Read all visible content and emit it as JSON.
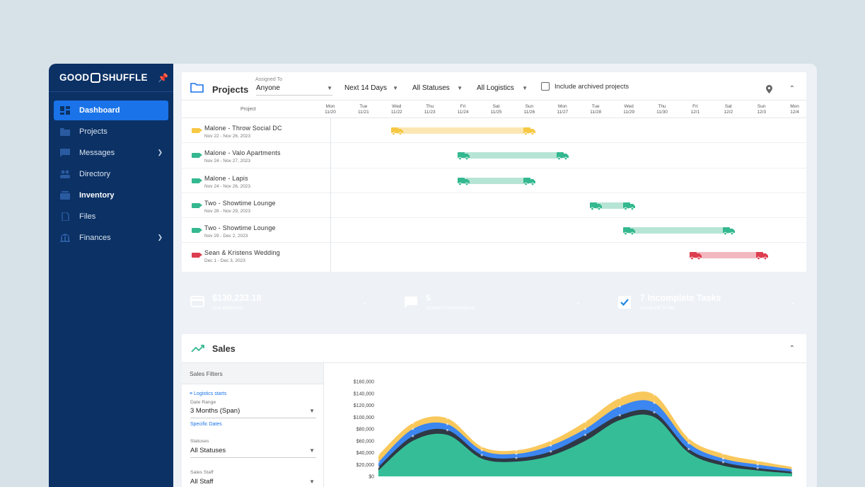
{
  "brand": {
    "logo_left": "GOOD",
    "logo_right": "SHUFFLE"
  },
  "sidebar": {
    "items": [
      {
        "label": "Dashboard",
        "icon": "dashboard-icon"
      },
      {
        "label": "Projects",
        "icon": "projects-icon"
      },
      {
        "label": "Messages",
        "icon": "messages-icon"
      },
      {
        "label": "Directory",
        "icon": "directory-icon"
      },
      {
        "label": "Inventory",
        "icon": "inventory-icon"
      },
      {
        "label": "Files",
        "icon": "files-icon"
      },
      {
        "label": "Finances",
        "icon": "finances-icon"
      }
    ]
  },
  "projects": {
    "title": "Projects",
    "assigned_label": "Assigned To",
    "assigned_value": "Anyone",
    "range_value": "Next 14 Days",
    "status_value": "All Statuses",
    "logistics_value": "All Logistics",
    "archived_label": "Include archived projects",
    "project_col": "Project",
    "days": [
      {
        "dow": "Mon",
        "date": "11/20"
      },
      {
        "dow": "Tue",
        "date": "11/21"
      },
      {
        "dow": "Wed",
        "date": "11/22"
      },
      {
        "dow": "Thu",
        "date": "11/23"
      },
      {
        "dow": "Fri",
        "date": "11/24"
      },
      {
        "dow": "Sat",
        "date": "11/25"
      },
      {
        "dow": "Sun",
        "date": "11/26"
      },
      {
        "dow": "Mon",
        "date": "11/27"
      },
      {
        "dow": "Tue",
        "date": "11/28"
      },
      {
        "dow": "Wed",
        "date": "11/29"
      },
      {
        "dow": "Thu",
        "date": "11/30"
      },
      {
        "dow": "Fri",
        "date": "12/1"
      },
      {
        "dow": "Sat",
        "date": "12/2"
      },
      {
        "dow": "Sun",
        "date": "12/3"
      },
      {
        "dow": "Mon",
        "date": "12/4"
      }
    ],
    "rows": [
      {
        "name": "Malone - Throw Social DC",
        "dates": "Nov 22 - Nov 26, 2023",
        "color": "#f7c844",
        "bar_color": "#fbe7b3",
        "start_day": 2,
        "end_day": 6
      },
      {
        "name": "Malone - Valo Apartments",
        "dates": "Nov 24 - Nov 27, 2023",
        "color": "#34b88f",
        "bar_color": "#b7e5d5",
        "start_day": 4,
        "end_day": 7
      },
      {
        "name": "Malone - Lapis",
        "dates": "Nov 24 - Nov 26, 2023",
        "color": "#34b88f",
        "bar_color": "#b7e5d5",
        "start_day": 4,
        "end_day": 6
      },
      {
        "name": "Two - Showtime Lounge",
        "dates": "Nov 28 - Nov 29, 2023",
        "color": "#34b88f",
        "bar_color": "#b7e5d5",
        "start_day": 8,
        "end_day": 9
      },
      {
        "name": "Two - Showtime Lounge",
        "dates": "Nov 29 - Dec 2, 2023",
        "color": "#34b88f",
        "bar_color": "#b7e5d5",
        "start_day": 9,
        "end_day": 12
      },
      {
        "name": "Sean & Kristens Wedding",
        "dates": "Dec 1 - Dec 3, 2023",
        "color": "#dd3e4f",
        "bar_color": "#f2b7bf",
        "start_day": 11,
        "end_day": 13
      }
    ]
  },
  "tiles": [
    {
      "big": "$130,233.18",
      "small": "Due Balances",
      "color": "#df4655",
      "icon": "credit-card-icon"
    },
    {
      "big": "5",
      "small": "Unread Conversations",
      "color": "#42a5f5",
      "icon": "chat-icon"
    },
    {
      "big": "7 Incomplete Tasks",
      "small": "Assigned To Me",
      "color": "#1e88e5",
      "icon": "checkbox-icon"
    }
  ],
  "sales": {
    "title": "Sales",
    "filters_header": "Sales Filters",
    "logistics_link": "Logistics starts",
    "date_range_label": "Date Range",
    "date_range_value": "3 Months (Span)",
    "specific_dates": "Specific Dates",
    "statuses_label": "Statuses",
    "statuses_value": "All Statuses",
    "staff_label": "Sales Staff",
    "staff_value": "All Staff"
  },
  "chart_data": {
    "type": "area",
    "yticks": [
      "$160,000",
      "$140,000",
      "$120,000",
      "$100,000",
      "$80,000",
      "$60,000",
      "$40,000",
      "$20,000",
      "$0"
    ],
    "ylim": [
      0,
      160000
    ],
    "series": [
      {
        "color": "#35bd97",
        "values": [
          10000,
          60000,
          70000,
          30000,
          25000,
          35000,
          60000,
          95000,
          100000,
          40000,
          18000,
          10000,
          5000
        ]
      },
      {
        "color": "#2f3844",
        "values": [
          16000,
          68000,
          78000,
          36000,
          31000,
          42000,
          70000,
          103000,
          108000,
          46000,
          24000,
          14000,
          8000
        ]
      },
      {
        "color": "#3b86f0",
        "values": [
          24000,
          80000,
          88000,
          44000,
          38000,
          52000,
          80000,
          118000,
          124000,
          56000,
          30000,
          20000,
          12000
        ]
      },
      {
        "color": "#f9c85c",
        "values": [
          36000,
          90000,
          98000,
          50000,
          44000,
          60000,
          92000,
          132000,
          138000,
          64000,
          38000,
          26000,
          16000
        ]
      }
    ]
  }
}
